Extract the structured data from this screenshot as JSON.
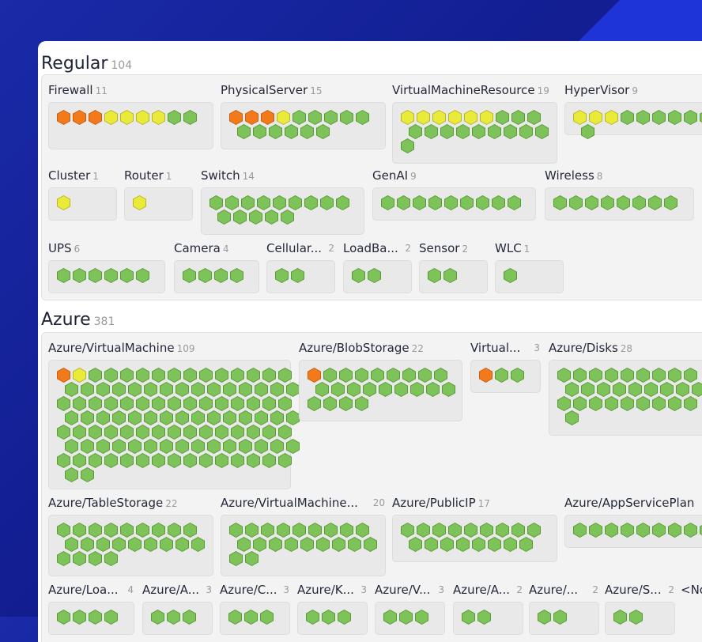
{
  "colors": {
    "ok": "#7ec25a",
    "warning": "#eaea3a",
    "critical": "#f27a1a",
    "background": "#1a2aa8"
  },
  "sections": [
    {
      "name": "Regular",
      "count": "104",
      "groups": [
        {
          "name": "Firewall",
          "count": "11",
          "states": "oooyyyygg",
          "wrap": 9
        },
        {
          "name": "PhysicalServer",
          "count": "15",
          "states": "oooyggggggggggg",
          "wrap": 9
        },
        {
          "name": "VirtualMachineResource",
          "count": "19",
          "states": "yyyyyyggggggggggggg",
          "wrap": 9
        },
        {
          "name": "HyperVisor",
          "count": "9",
          "states": "yyyggggggg",
          "wrap": 9
        },
        {
          "name": "Cluster",
          "count": "1",
          "states": "y",
          "wrap": 9
        },
        {
          "name": "Router",
          "count": "1",
          "states": "y",
          "wrap": 9
        },
        {
          "name": "Switch",
          "count": "14",
          "states": "gggggggggggggg",
          "wrap": 9
        },
        {
          "name": "GenAI",
          "count": "9",
          "states": "ggggggggg",
          "wrap": 9
        },
        {
          "name": "Wireless",
          "count": "8",
          "states": "gggggggg",
          "wrap": 9
        },
        {
          "name": "UPS",
          "count": "6",
          "states": "gggggg",
          "wrap": 9
        },
        {
          "name": "Camera",
          "count": "4",
          "states": "gggg",
          "wrap": 9
        },
        {
          "name": "Cellular...",
          "count": "2",
          "states": "gg",
          "wrap": 9
        },
        {
          "name": "LoadBa...",
          "count": "2",
          "states": "gg",
          "wrap": 9
        },
        {
          "name": "Sensor",
          "count": "2",
          "states": "gg",
          "wrap": 9
        },
        {
          "name": "WLC",
          "count": "1",
          "states": "g",
          "wrap": 9
        }
      ]
    },
    {
      "name": "Azure",
      "count": "381",
      "groups": [
        {
          "name": "Azure/VirtualMachine",
          "count": "109",
          "states": "oyggggggggggggggggggggggggggggggggggggggggggggggggggggggggggggggggggggggggggggggggggggggggggggggggggggggggg",
          "wrap": 15
        },
        {
          "name": "Azure/BlobStorage",
          "count": "22",
          "states": "oggggggggggggggggggggg",
          "wrap": 9
        },
        {
          "name": "Virtual...",
          "count": "3",
          "states": "ogg",
          "wrap": 9
        },
        {
          "name": "Azure/Disks",
          "count": "28",
          "states": "gggggggggggggggggggggggggggg",
          "wrap": 9
        },
        {
          "name": "Azure/TableStorage",
          "count": "22",
          "states": "gggggggggggggggggggggg",
          "wrap": 9
        },
        {
          "name": "Azure/VirtualMachine...",
          "count": "20",
          "states": "gggggggggggggggggggg",
          "wrap": 9
        },
        {
          "name": "Azure/PublicIP",
          "count": "17",
          "states": "ggggggggggggggggg",
          "wrap": 9
        },
        {
          "name": "Azure/AppServicePlan",
          "count": "",
          "states": "gggggggggg",
          "wrap": 10
        },
        {
          "name": "Azure/Loa...",
          "count": "4",
          "states": "gggg",
          "wrap": 9
        },
        {
          "name": "Azure/A...",
          "count": "3",
          "states": "ggg",
          "wrap": 9
        },
        {
          "name": "Azure/C...",
          "count": "3",
          "states": "ggg",
          "wrap": 9
        },
        {
          "name": "Azure/K...",
          "count": "3",
          "states": "ggg",
          "wrap": 9
        },
        {
          "name": "Azure/V...",
          "count": "3",
          "states": "ggg",
          "wrap": 9
        },
        {
          "name": "Azure/A...",
          "count": "2",
          "states": "gg",
          "wrap": 9
        },
        {
          "name": "Azure/...",
          "count": "2",
          "states": "gg",
          "wrap": 9
        },
        {
          "name": "Azure/S...",
          "count": "2",
          "states": "gg",
          "wrap": 9
        },
        {
          "name": "<No",
          "count": "",
          "states": "",
          "wrap": 9
        }
      ]
    }
  ]
}
